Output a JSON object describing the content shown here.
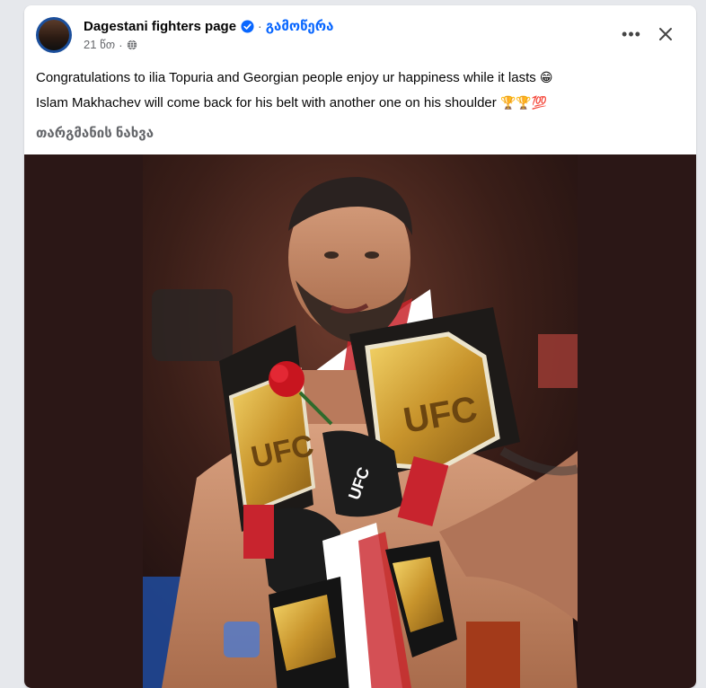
{
  "post": {
    "page_name": "Dagestani fighters page",
    "separator": "·",
    "follow_label": "გამოწერა",
    "timestamp": "21 წთ",
    "meta_separator": "·",
    "lines": [
      "Congratulations to ilia Topuria and Georgian people enjoy ur happiness while it lasts",
      "Islam Makhachev will come back for his belt with another one on his shoulder"
    ],
    "line_emojis": [
      "😁",
      "🏆🏆💯"
    ],
    "see_translation": "თარგმანის ნახვა",
    "more_label": "•••"
  },
  "icons": {
    "verified": "verified-badge-icon",
    "privacy": "globe-icon",
    "more": "more-options-icon",
    "close": "close-icon"
  },
  "photo": {
    "belt_text_1": "UFC",
    "belt_text_2": "UFC",
    "glove_text": "UFC"
  },
  "colors": {
    "accent": "#0866ff",
    "secondary_text": "#65676b",
    "media_background": "#2b1716"
  }
}
